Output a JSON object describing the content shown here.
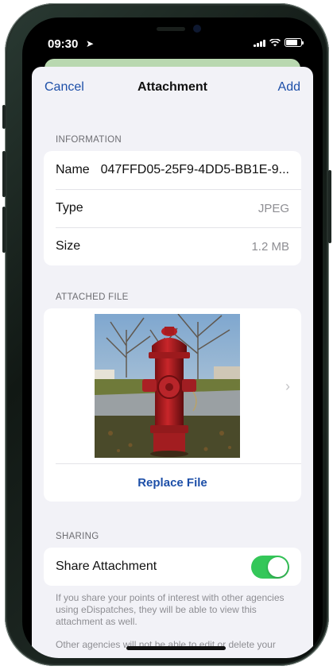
{
  "status_bar": {
    "time": "09:30",
    "location_arrow": "➤",
    "signal_bars": 4,
    "wifi_icon": "wifi-icon",
    "battery_level": 0.85
  },
  "nav": {
    "cancel": "Cancel",
    "title": "Attachment",
    "add": "Add"
  },
  "information": {
    "header": "INFORMATION",
    "rows": [
      {
        "label": "Name",
        "value": "047FFD05-25F9-4DD5-BB1E-9..."
      },
      {
        "label": "Type",
        "value": "JPEG"
      },
      {
        "label": "Size",
        "value": "1.2 MB"
      }
    ]
  },
  "attached_file": {
    "header": "ATTACHED FILE",
    "image": "photo of a red fire hydrant",
    "chevron": "›",
    "replace_label": "Replace File"
  },
  "sharing": {
    "header": "SHARING",
    "toggle_label": "Share Attachment",
    "toggle_on": true,
    "footnote_1": "If you share your points of interest with other agencies using eDispatches, they will be able to view this attachment as well.",
    "footnote_2": "Other agencies will not be able to edit or delete your"
  },
  "colors": {
    "accent": "#1d4fa8",
    "toggle_on": "#34c759",
    "background": "#f2f2f7"
  }
}
